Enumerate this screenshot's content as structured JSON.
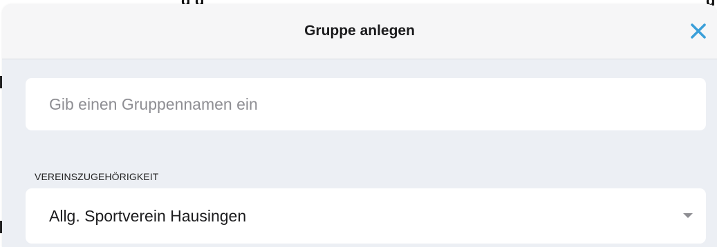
{
  "background": {
    "partial_text_left": "g g",
    "partial_text_right": "g"
  },
  "modal": {
    "title": "Gruppe anlegen",
    "close_icon": "close-x-icon",
    "accent_color": "#3a9fd9"
  },
  "name_field": {
    "value": "",
    "placeholder": "Gib einen Gruppennamen ein"
  },
  "club": {
    "label": "VEREINSZUGEHÖRIGKEIT",
    "selected": "Allg. Sportverein Hausingen",
    "dropdown_icon": "chevron-down-icon"
  }
}
